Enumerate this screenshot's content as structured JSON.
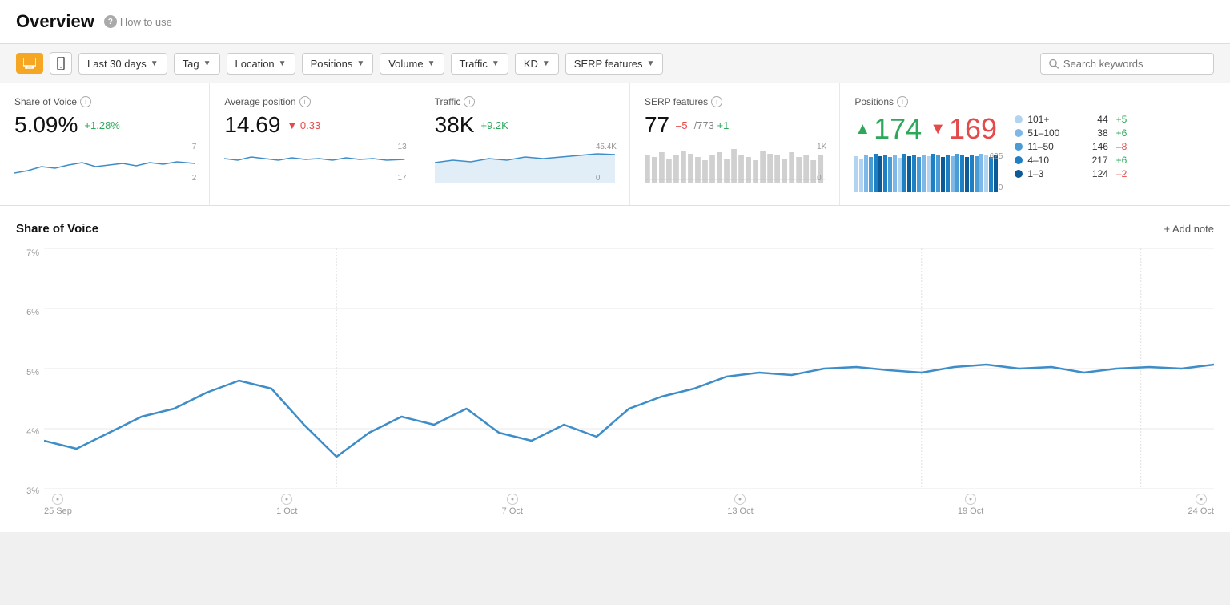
{
  "header": {
    "title": "Overview",
    "how_to_use": "How to use"
  },
  "toolbar": {
    "view_desktop_label": "desktop",
    "view_mobile_label": "mobile",
    "last30days_label": "Last 30 days",
    "tag_label": "Tag",
    "location_label": "Location",
    "positions_label": "Positions",
    "volume_label": "Volume",
    "traffic_label": "Traffic",
    "kd_label": "KD",
    "serp_features_label": "SERP features",
    "search_placeholder": "Search keywords"
  },
  "metrics": {
    "share_of_voice": {
      "label": "Share of Voice",
      "value": "5.09%",
      "change": "+1.28%",
      "change_type": "positive",
      "y_top": "7",
      "y_bottom": "2"
    },
    "avg_position": {
      "label": "Average position",
      "value": "14.69",
      "change": "0.33",
      "change_type": "negative",
      "y_top": "13",
      "y_bottom": "17"
    },
    "traffic": {
      "label": "Traffic",
      "value": "38K",
      "change": "+9.2K",
      "change_type": "positive",
      "y_top": "45.4K",
      "y_bottom": "0"
    },
    "serp_features": {
      "label": "SERP features",
      "value": "77",
      "change_neg": "–5",
      "total": "/773",
      "change_pos": "+1",
      "y_top": "1K",
      "y_bottom": "0"
    },
    "positions": {
      "label": "Positions",
      "up_value": "174",
      "down_value": "169",
      "y_top": "625",
      "y_bottom": "0",
      "legend": [
        {
          "label": "101+",
          "count": "44",
          "change": "+5",
          "change_type": "positive",
          "color": "#b3d4f0"
        },
        {
          "label": "51–100",
          "count": "38",
          "change": "+6",
          "change_type": "positive",
          "color": "#7eb8e8"
        },
        {
          "label": "11–50",
          "count": "146",
          "change": "–8",
          "change_type": "negative",
          "color": "#4a9dd4"
        },
        {
          "label": "4–10",
          "count": "217",
          "change": "+6",
          "change_type": "positive",
          "color": "#1d7fc4"
        },
        {
          "label": "1–3",
          "count": "124",
          "change": "–2",
          "change_type": "negative",
          "color": "#0e5a96"
        }
      ]
    }
  },
  "share_of_voice_chart": {
    "title": "Share of Voice",
    "add_note_label": "+ Add note",
    "y_labels": [
      "7%",
      "6%",
      "5%",
      "4%",
      "3%"
    ],
    "x_labels": [
      "25 Sep",
      "1 Oct",
      "7 Oct",
      "13 Oct",
      "19 Oct",
      "24 Oct"
    ]
  },
  "colors": {
    "accent_orange": "#f5a623",
    "line_blue": "#3d8dc9",
    "positive_green": "#2da85a",
    "negative_red": "#e54a4a"
  }
}
